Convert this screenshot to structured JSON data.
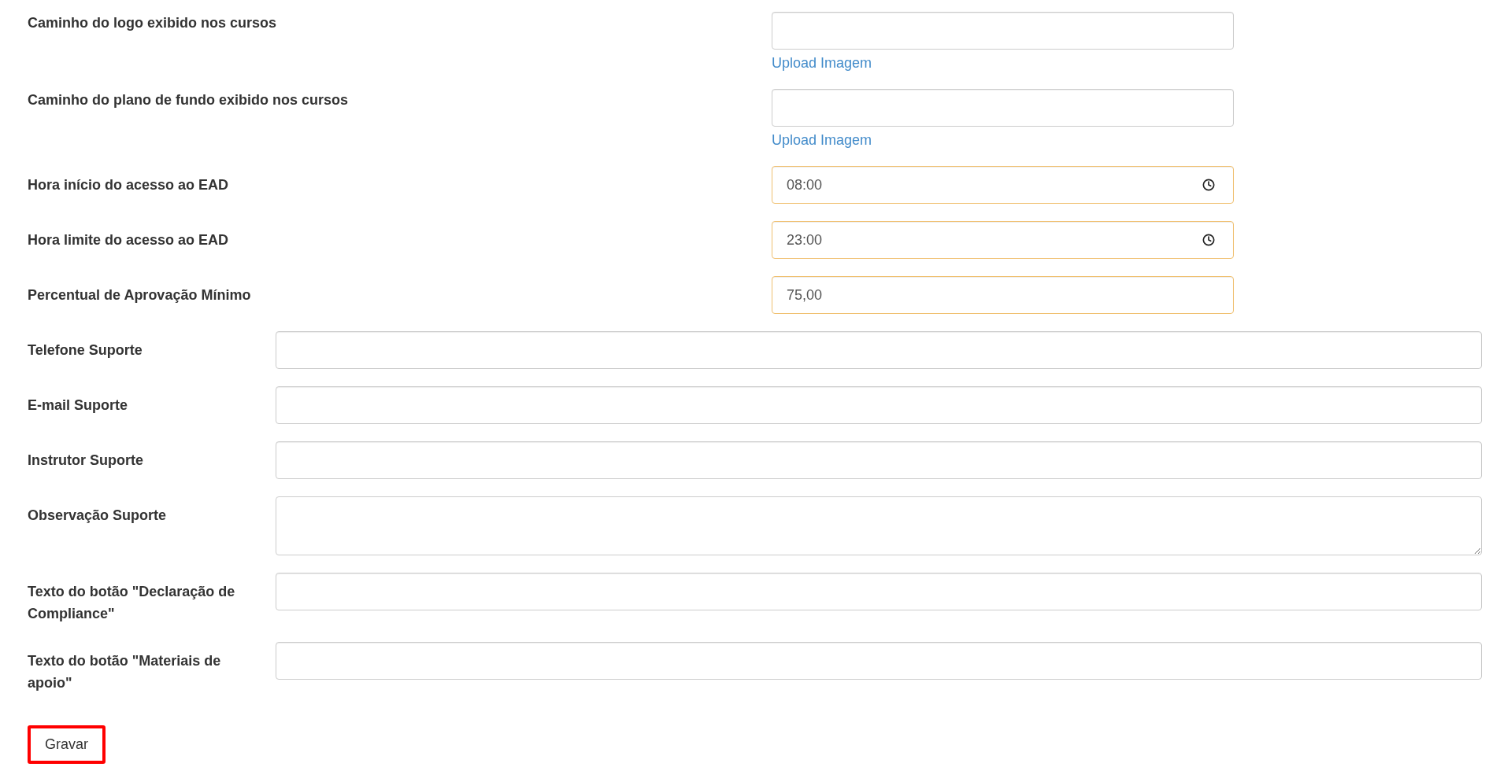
{
  "top_fields": [
    {
      "kind": "file",
      "label": "Caminho do logo exibido nos cursos",
      "link": "Upload Imagem",
      "highlighted": false
    },
    {
      "kind": "file",
      "label": "Caminho do plano de fundo exibido nos cursos",
      "link": "Upload Imagem",
      "highlighted": false
    },
    {
      "kind": "time",
      "label": "Hora início do acesso ao EAD",
      "value": "08:00",
      "highlighted": true
    },
    {
      "kind": "time",
      "label": "Hora limite do acesso ao EAD",
      "value": "23:00",
      "highlighted": true
    },
    {
      "kind": "text",
      "label": "Percentual de Aprovação Mínimo",
      "value": "75,00",
      "highlighted": true
    }
  ],
  "support_fields": [
    {
      "kind": "text",
      "label": "Telefone Suporte"
    },
    {
      "kind": "text",
      "label": "E-mail Suporte"
    },
    {
      "kind": "text",
      "label": "Instrutor Suporte"
    },
    {
      "kind": "textarea",
      "label": "Observação Suporte"
    },
    {
      "kind": "text",
      "label": "Texto do botão \"Declaração de Compliance\""
    },
    {
      "kind": "text",
      "label": "Texto do botão \"Materiais de apoio\""
    }
  ],
  "save_button": {
    "label": "Gravar",
    "highlighted": true
  }
}
